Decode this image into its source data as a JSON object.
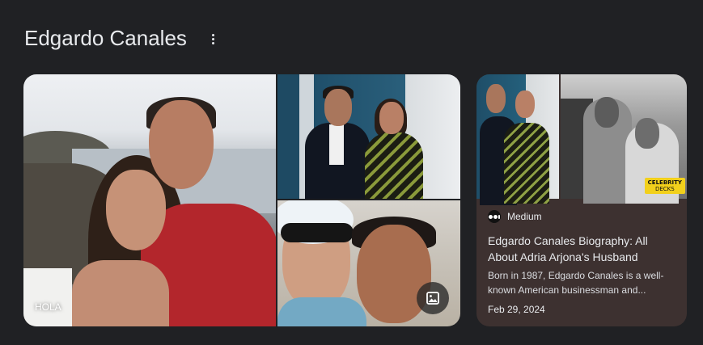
{
  "header": {
    "title": "Edgardo Canales",
    "more_icon": "more-vertical-icon"
  },
  "gallery": {
    "photo1": {
      "label": "HOLA"
    },
    "image_button_icon": "image-icon"
  },
  "card": {
    "source": "Medium",
    "source_icon": "medium-logo-icon",
    "badge_line1": "CELEBRITY",
    "badge_line2": "DECKS",
    "title": "Edgardo Canales Biography: All About Adria Arjona's Husband",
    "snippet": "Born in 1987, Edgardo Canales is a well-known American businessman and...",
    "date": "Feb 29, 2024"
  },
  "colors": {
    "background": "#202124",
    "card_background": "#3d3130",
    "text": "#e8eaed"
  }
}
